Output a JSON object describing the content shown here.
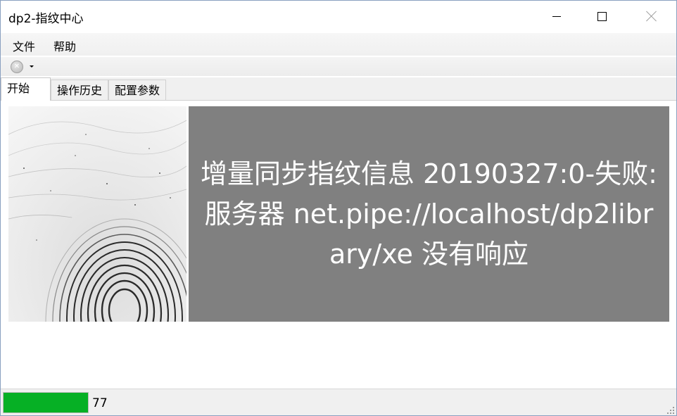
{
  "window": {
    "title": "dp2-指纹中心"
  },
  "menubar": {
    "items": [
      {
        "label": "文件"
      },
      {
        "label": "帮助"
      }
    ]
  },
  "toolbar": {
    "stop_icon": "stop-circle-icon",
    "stop_glyph": "✕"
  },
  "tabs": [
    {
      "label": "开始",
      "active": true
    },
    {
      "label": "操作历史",
      "active": false
    },
    {
      "label": "配置参数",
      "active": false
    }
  ],
  "content": {
    "image_icon": "fingerprint-image",
    "message": "增量同步指纹信息 20190327:0-失败: 服务器 net.pipe://localhost/dp2library/xe 没有响应",
    "message_bg": "#808080"
  },
  "statusbar": {
    "progress": 1.0,
    "progress_color": "#06b025",
    "text": "77"
  }
}
